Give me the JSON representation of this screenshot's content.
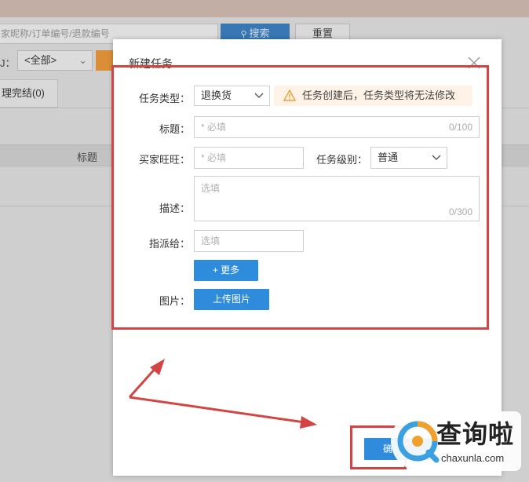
{
  "background": {
    "search_placeholder": "家昵称/订单编号/退款编号",
    "search_button": "搜索",
    "reset_button": "重置",
    "filter_label": "J：",
    "filter_select_value": "<全部>",
    "tab_label": "理完结(0)",
    "column_title": "标题"
  },
  "modal": {
    "title": "新建任务",
    "task_type": {
      "label": "任务类型：",
      "value": "退换货"
    },
    "warning": "任务创建后，任务类型将无法修改",
    "title_field": {
      "label": "标题：",
      "placeholder": "* 必填",
      "counter": "0/100"
    },
    "buyer": {
      "label": "买家旺旺：",
      "placeholder": "* 必填"
    },
    "level": {
      "label": "任务级别：",
      "value": "普通"
    },
    "description": {
      "label": "描述：",
      "placeholder": "选填",
      "counter": "0/300"
    },
    "assign": {
      "label": "指派给：",
      "placeholder": "选填"
    },
    "more_button": "+ 更多",
    "image_label": "图片：",
    "upload_button": "上传图片",
    "confirm_button_fragment": "确"
  },
  "watermark": {
    "cn": "查询啦",
    "en": "chaxunla.com"
  },
  "colors": {
    "primary": "#2f8bdc",
    "annotation_red": "#d34545",
    "warning_bg": "#fff3e7",
    "warning_icon": "#e8a33d"
  },
  "icons": {
    "search": "search-icon",
    "close": "close-icon",
    "dropdown": "chevron-down-icon",
    "warning": "warning-triangle-icon"
  }
}
